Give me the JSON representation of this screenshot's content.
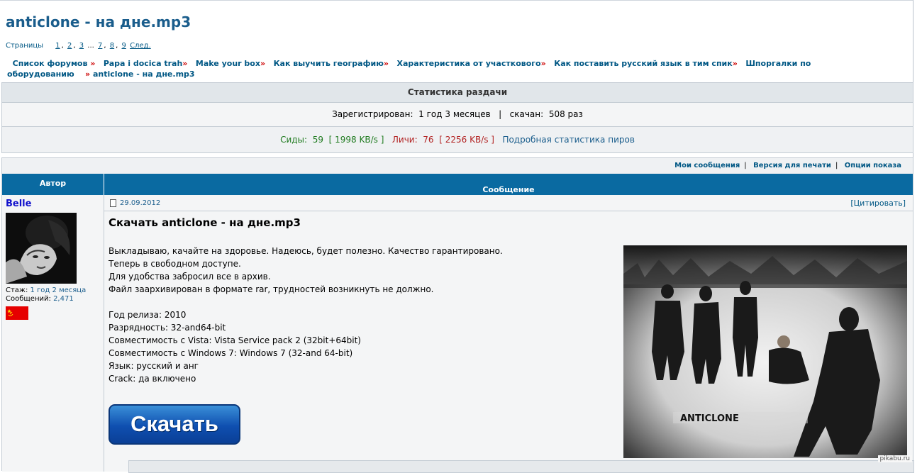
{
  "topic": {
    "title": "anticlone - на дне.mp3"
  },
  "pagination": {
    "label": "Страницы",
    "pages": [
      "1",
      "2",
      "3",
      "7",
      "8",
      "9"
    ],
    "ellipsis": "...",
    "next": "След."
  },
  "breadcrumbs": [
    "Список форумов",
    "Papa i docica trah",
    "Make your box",
    "Как выучить географию",
    "Характеристика от участкового",
    "Как поставить русский язык в тим спик",
    "Шпоргалки по оборудованию",
    "anticlone - на дне.mp3"
  ],
  "stats": {
    "header": "Статистика раздачи",
    "registered_label": "Зарегистрирован:",
    "registered_value": "1 год 3 месяцев",
    "downloaded_label": "скачан:",
    "downloaded_value": "508 раз",
    "seeds_label": "Сиды:",
    "seeds_value": "59",
    "seeds_speed": "1998",
    "leech_label": "Личи:",
    "leech_value": "76",
    "leech_speed": "2256",
    "speed_unit": "KB/s",
    "peers_link": "Подробная статистика пиров"
  },
  "options": {
    "my_messages": "Мои сообщения",
    "print_version": "Версия для печати",
    "view_options": "Опции показа"
  },
  "table": {
    "author_header": "Автор",
    "message_header": "Сообщение"
  },
  "post": {
    "author": "Belle",
    "tenure_label": "Стаж:",
    "tenure_value": "1 год 2 месяца",
    "messages_label": "Сообщений:",
    "messages_value": "2,471",
    "date": "29.09.2012",
    "quote": "[Цитировать]",
    "title": "Скачать anticlone - на дне.mp3",
    "lines": [
      "Выкладываю, качайте на здоровье. Надеюсь, будет полезно. Качество гарантировано.",
      "Теперь в свободном доступе.",
      "Для удобства забросил все в архив.",
      "Файл заархивирован в формате rar, трудностей возникнуть не должно."
    ],
    "details": [
      "Год релиза: 2010",
      "Разрядность: 32-and64-bit",
      "Совместимость с Vista: Vista Service pack 2 (32bit+64bit)",
      "Совместимость с Windows 7: Windows 7 (32-and 64-bit)",
      "Язык: русский и анг",
      "Crack: да включено"
    ],
    "download_button": "Скачать",
    "image_caption": "ANTICLONE"
  },
  "watermark": "pikabu.ru"
}
